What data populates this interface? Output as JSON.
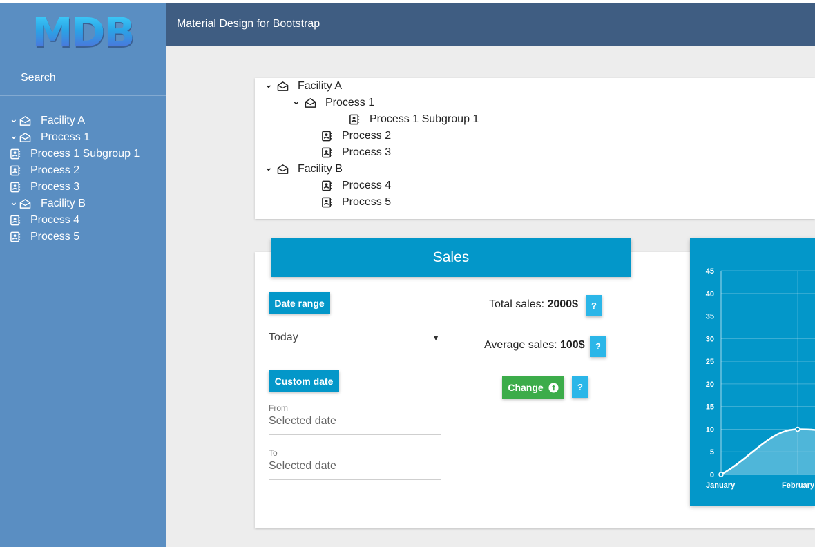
{
  "logo": "MDB",
  "header": {
    "title": "Material Design for Bootstrap"
  },
  "sidebar": {
    "search_label": "Search",
    "items": [
      {
        "label": "Facility A",
        "type": "folder",
        "expanded": true
      },
      {
        "label": "Process 1",
        "type": "folder",
        "expanded": true
      },
      {
        "label": "Process 1 Subgroup 1",
        "type": "leaf"
      },
      {
        "label": "Process 2",
        "type": "leaf"
      },
      {
        "label": "Process 3",
        "type": "leaf"
      },
      {
        "label": "Facility B",
        "type": "folder",
        "expanded": true
      },
      {
        "label": "Process 4",
        "type": "leaf"
      },
      {
        "label": "Process 5",
        "type": "leaf"
      }
    ]
  },
  "tree": {
    "items": [
      {
        "label": "Facility A",
        "level": 0,
        "type": "folder"
      },
      {
        "label": "Process 1",
        "level": 1,
        "type": "folder"
      },
      {
        "label": "Process 1 Subgroup 1",
        "level": 2,
        "type": "leaf"
      },
      {
        "label": "Process 2",
        "level": 1,
        "type": "leaf"
      },
      {
        "label": "Process 3",
        "level": 1,
        "type": "leaf"
      },
      {
        "label": "Facility B",
        "level": 0,
        "type": "folder"
      },
      {
        "label": "Process 4",
        "level": 1,
        "type": "leaf"
      },
      {
        "label": "Process 5",
        "level": 1,
        "type": "leaf"
      }
    ]
  },
  "sales": {
    "title": "Sales",
    "date_range_label": "Date range",
    "range_selected": "Today",
    "custom_date_label": "Custom date",
    "from_label": "From",
    "from_placeholder": "Selected date",
    "to_label": "To",
    "to_placeholder": "Selected date",
    "total_label": "Total sales:",
    "total_value": "2000$",
    "average_label": "Average sales:",
    "average_value": "100$",
    "change_label": "Change",
    "help_label": "?"
  },
  "colors": {
    "sidebar": "#5a8ec2",
    "header": "#3f5d82",
    "primary": "#0397c9",
    "help": "#2bb6e8",
    "success": "#3cac4a"
  },
  "chart_data": {
    "type": "line",
    "categories": [
      "January",
      "February"
    ],
    "values": [
      0,
      10
    ],
    "y_ticks": [
      0,
      5,
      10,
      15,
      20,
      25,
      30,
      35,
      40,
      45
    ],
    "ylim": [
      0,
      45
    ],
    "grid": true,
    "fill": true
  }
}
